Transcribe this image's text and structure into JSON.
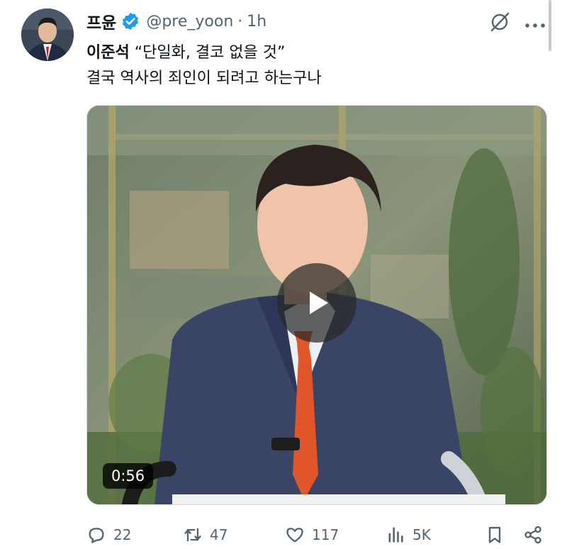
{
  "tweet": {
    "author_name": "프윤",
    "handle": "@pre_yoon",
    "separator": "·",
    "time": "1h",
    "line1_bold": "이준석",
    "line1_rest": " “단일화, 결코 없을 것”",
    "line2": "결국 역사의 죄인이 되려고 하는구나"
  },
  "media": {
    "duration": "0:56"
  },
  "actions": {
    "replies": "22",
    "reposts": "47",
    "likes": "117",
    "views": "5K"
  },
  "colors": {
    "verified": "#1d9bf0",
    "text": "#0f1419",
    "muted": "#536471",
    "tie": "#e0552a",
    "suit": "#3a4466"
  },
  "icons": [
    "verified-badge-icon",
    "grok-icon",
    "more-icon",
    "play-icon",
    "reply-icon",
    "repost-icon",
    "like-icon",
    "views-icon",
    "bookmark-icon",
    "share-icon"
  ]
}
